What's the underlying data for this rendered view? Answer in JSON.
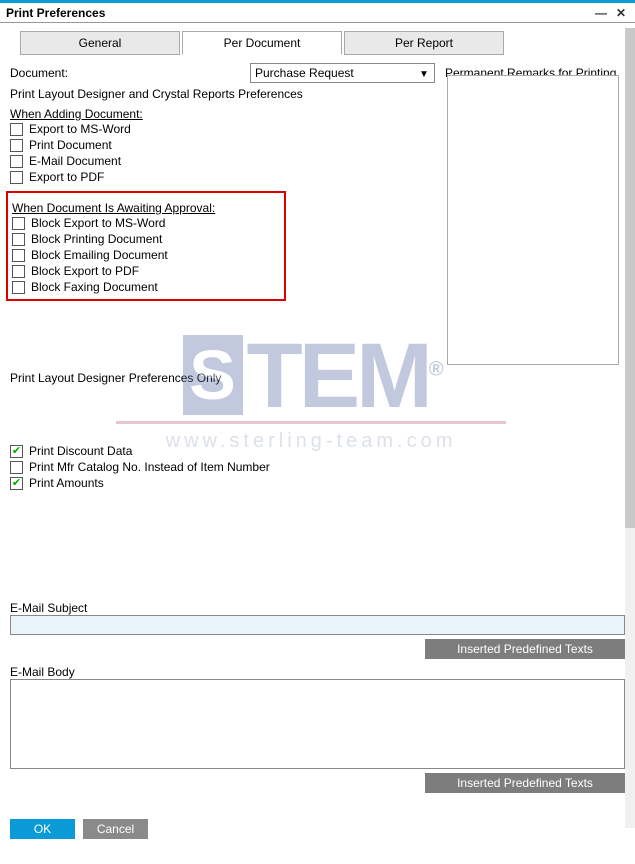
{
  "window": {
    "title": "Print Preferences"
  },
  "tabs": {
    "general": "General",
    "per_document": "Per Document",
    "per_report": "Per Report"
  },
  "document": {
    "label": "Document:",
    "selected": "Purchase Request"
  },
  "remarks_label": "Permanent Remarks for Printing",
  "pref_header": "Print Layout Designer and Crystal Reports Preferences",
  "when_adding": {
    "title": "When Adding Document:",
    "items": [
      {
        "label": "Export to MS-Word",
        "checked": false
      },
      {
        "label": "Print Document",
        "checked": false
      },
      {
        "label": "E-Mail Document",
        "checked": false
      },
      {
        "label": "Export to PDF",
        "checked": false
      }
    ]
  },
  "awaiting": {
    "title": "When Document Is Awaiting Approval:",
    "items": [
      {
        "label": "Block Export to MS-Word",
        "checked": false
      },
      {
        "label": "Block Printing Document",
        "checked": false
      },
      {
        "label": "Block Emailing Document",
        "checked": false
      },
      {
        "label": "Block Export to PDF",
        "checked": false
      },
      {
        "label": "Block Faxing Document",
        "checked": false
      }
    ]
  },
  "pldonly": {
    "title": "Print Layout Designer Preferences Only",
    "items": [
      {
        "label": "Print Discount Data",
        "checked": true
      },
      {
        "label": "Print Mfr Catalog No. Instead of Item Number",
        "checked": false
      },
      {
        "label": "Print Amounts",
        "checked": true
      }
    ]
  },
  "email_subject_label": "E-Mail Subject",
  "email_subject_value": "",
  "email_body_label": "E-Mail Body",
  "email_body_value": "",
  "predef_btn": "Inserted Predefined Texts",
  "buttons": {
    "ok": "OK",
    "cancel": "Cancel"
  },
  "watermark": {
    "text": "STEM",
    "url": "www.sterling-team.com"
  }
}
